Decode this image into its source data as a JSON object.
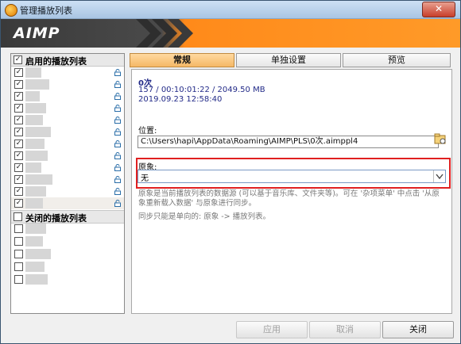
{
  "window": {
    "title": "管理播放列表",
    "close_glyph": "✕"
  },
  "banner": {
    "logo": "AIMP",
    "accent": "#ff9a28"
  },
  "sidebar": {
    "enabled_header": "启用的播放列表",
    "disabled_header": "关闭的播放列表",
    "enabled_count": 12,
    "disabled_count": 5
  },
  "tabs": [
    "常规",
    "单独设置",
    "预览"
  ],
  "general": {
    "name": "0次",
    "stats": "157 / 00:10:01:22 / 2049.50 MB",
    "date": "2019.09.23 12:58:40",
    "location_label": "位置:",
    "location_path": "C:\\Users\\hapi\\AppData\\Roaming\\AIMP\\PLS\\0次.aimppl4",
    "source_label": "原象:",
    "source_value": "无",
    "description": "原象是当前播放列表的数据源 (可以基于音乐库、文件夹等)。可在 '杂项菜单' 中点击 '从原象重新载入数据' 与原象进行同步。",
    "sync_note": "同步只能是单向的: 原象 -> 播放列表。"
  },
  "buttons": {
    "apply": "应用",
    "cancel": "取消",
    "close": "关闭"
  },
  "highlight_color": "#e02020"
}
